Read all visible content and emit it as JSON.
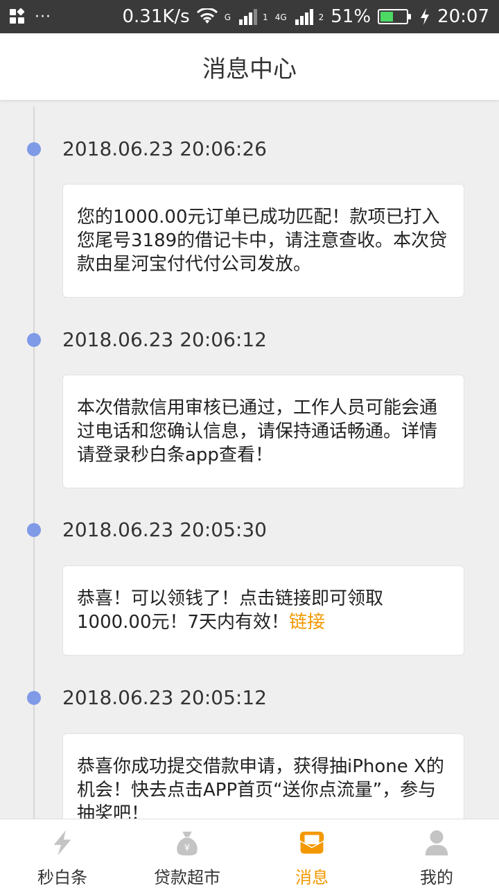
{
  "status_bar": {
    "dots": "···",
    "speed": "0.31K/s",
    "net_g": "G",
    "sim1": "1",
    "net_4g": "4G",
    "sim2": "2",
    "battery": "51%",
    "battery_level": 0.51,
    "time": "20:07"
  },
  "header": {
    "title": "消息中心"
  },
  "messages": [
    {
      "time": "2018.06.23 20:06:26",
      "text": "您的1000.00元订单已成功匹配！款项已打入您尾号3189的借记卡中，请注意查收。本次贷款由星河宝付代付公司发放。"
    },
    {
      "time": "2018.06.23 20:06:12",
      "text": "本次借款信用审核已通过，工作人员可能会通过电话和您确认信息，请保持通话畅通。详情请登录秒白条app查看！"
    },
    {
      "time": "2018.06.23 20:05:30",
      "text": "恭喜！可以领钱了！点击链接即可领取1000.00元！7天内有效！",
      "link_text": "链接"
    },
    {
      "time": "2018.06.23 20:05:12",
      "text": "恭喜你成功提交借款申请，获得抽iPhone X的机会！快去点击APP首页“送你点流量”，参与抽奖吧！"
    }
  ],
  "bottom_nav": [
    {
      "label": "秒白条",
      "icon": "lightning-icon",
      "active": false
    },
    {
      "label": "贷款超市",
      "icon": "money-bag-icon",
      "active": false
    },
    {
      "label": "消息",
      "icon": "message-envelope-icon",
      "active": true
    },
    {
      "label": "我的",
      "icon": "user-icon",
      "active": false
    }
  ],
  "colors": {
    "accent": "#f39800",
    "timeline_dot": "#7f9ae6",
    "status_bar": "#3a3a3a",
    "inactive_icon": "#bdbdbd"
  }
}
